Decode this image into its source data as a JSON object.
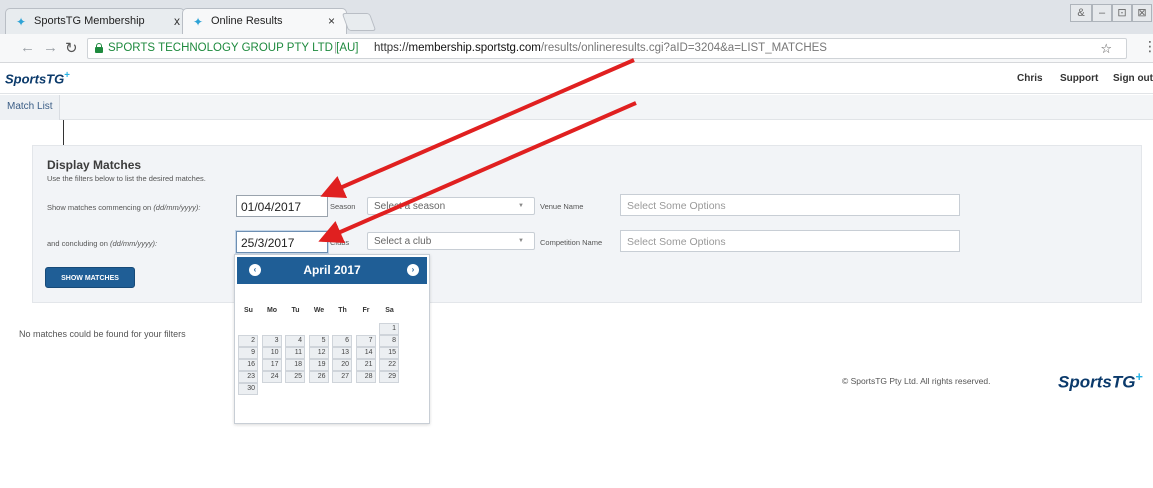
{
  "browser": {
    "tabs": [
      {
        "label": "SportsTG Membership",
        "close": "x"
      },
      {
        "label": "Online Results",
        "close": "×"
      }
    ],
    "window_buttons": [
      "&",
      "–",
      "⊡",
      "⊠"
    ],
    "secure_label": "SPORTS TECHNOLOGY GROUP PTY LTD [AU]",
    "url_scheme": "https://",
    "url_host": "membership.sportstg.com",
    "url_path": "/results/onlineresults.cgi?aID=3204&a=LIST_MATCHES",
    "separator": "|"
  },
  "site": {
    "logo_text": "SportsTG",
    "logo_plus": "+",
    "header_links": [
      "Chris",
      "Support",
      "Sign out"
    ],
    "subnav_tab": "Match List"
  },
  "filters": {
    "title": "Display Matches",
    "subtitle": "Use the filters below to list the desired matches.",
    "start_label": "Show matches commencing on",
    "start_hint": "(dd/mm/yyyy):",
    "start_value": "01/04/2017",
    "end_label": "and concluding on",
    "end_hint": "(dd/mm/yyyy):",
    "end_value": "25/3/2017",
    "season_label": "Season",
    "season_value": "Select a season",
    "club_label": "Clubs",
    "club_value": "Select a club",
    "venue_label": "Venue Name",
    "venue_placeholder": "Select Some Options",
    "competition_label": "Competition Name",
    "competition_placeholder": "Select Some Options",
    "show_button": "SHOW MATCHES"
  },
  "results": {
    "empty_message": "No matches could be found for your filters"
  },
  "footer": {
    "copyright": "© SportsTG Pty Ltd. All rights reserved.",
    "logo_text": "SportsTG",
    "logo_plus": "+"
  },
  "datepicker": {
    "month_title": "April 2017",
    "prev": "‹",
    "next": "›",
    "weekdays": [
      "Su",
      "Mo",
      "Tu",
      "We",
      "Th",
      "Fr",
      "Sa"
    ],
    "first_weekday_index": 6,
    "days_in_month": 30
  },
  "colors": {
    "brand_blue": "#1f5e96",
    "logo_navy": "#0b3a6b",
    "logo_accent": "#27b3e6",
    "annotation_arrow": "#e02020",
    "secure_green": "#1e8a3e"
  },
  "icons": [
    "back-icon",
    "forward-icon",
    "reload-icon",
    "lock-icon",
    "star-icon",
    "menu-kebab-icon",
    "tab-favicon-icon",
    "dropdown-caret-icon",
    "prev-month-icon",
    "next-month-icon"
  ]
}
